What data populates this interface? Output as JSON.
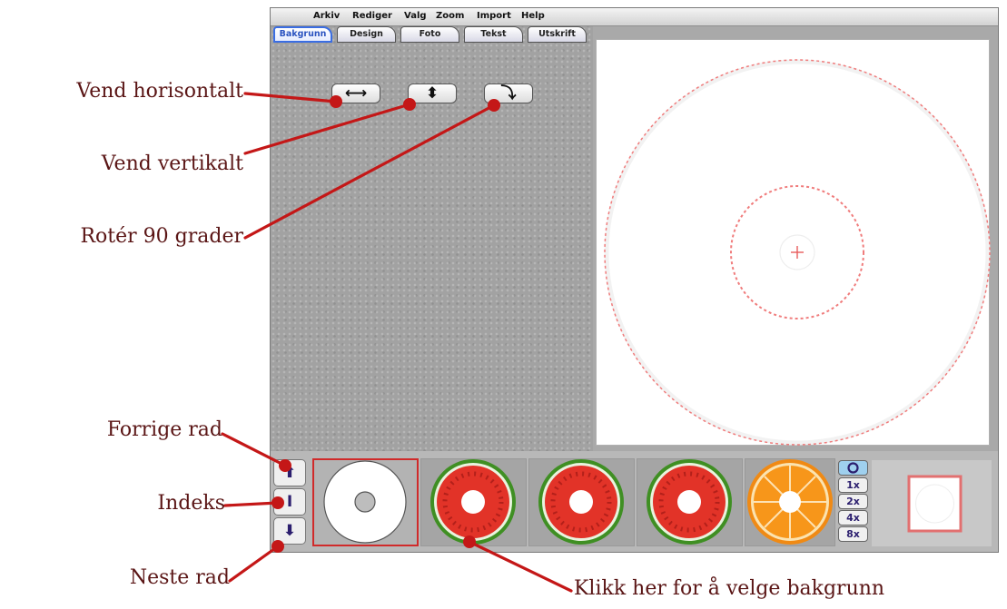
{
  "menu": [
    "Arkiv",
    "Rediger",
    "Valg",
    "Zoom",
    "Import",
    "Help"
  ],
  "tabs": [
    {
      "label": "Bakgrunn",
      "active": true
    },
    {
      "label": "Design",
      "active": false
    },
    {
      "label": "Foto",
      "active": false
    },
    {
      "label": "Tekst",
      "active": false
    },
    {
      "label": "Utskrift",
      "active": false
    }
  ],
  "tools": [
    {
      "icon": "arrow-left-right-icon",
      "glyph": "⟷"
    },
    {
      "icon": "arrow-up-down-icon",
      "glyph": "⬍"
    },
    {
      "icon": "rotate-icon",
      "glyph": "⤵"
    }
  ],
  "nav": {
    "prev_glyph": "⬆",
    "index_glyph": "I",
    "next_glyph": "⬇"
  },
  "thumbnails": [
    "blank-disc",
    "watermelon",
    "watermelon",
    "watermelon",
    "orange"
  ],
  "zoom_options": [
    "1x",
    "2x",
    "4x",
    "8x"
  ],
  "callouts": {
    "flip_h": "Vend horisontalt",
    "flip_v": "Vend vertikalt",
    "rotate": "Rotér 90 grader",
    "prev_row": "Forrige rad",
    "index": "Indeks",
    "next_row": "Neste rad",
    "pick_bg": "Klikk her for å velge bakgrunn"
  },
  "colors": {
    "accent": "#3a6de2",
    "callout_line": "#c41717",
    "callout_text": "#5a1515",
    "guide": "#f07c7c"
  }
}
